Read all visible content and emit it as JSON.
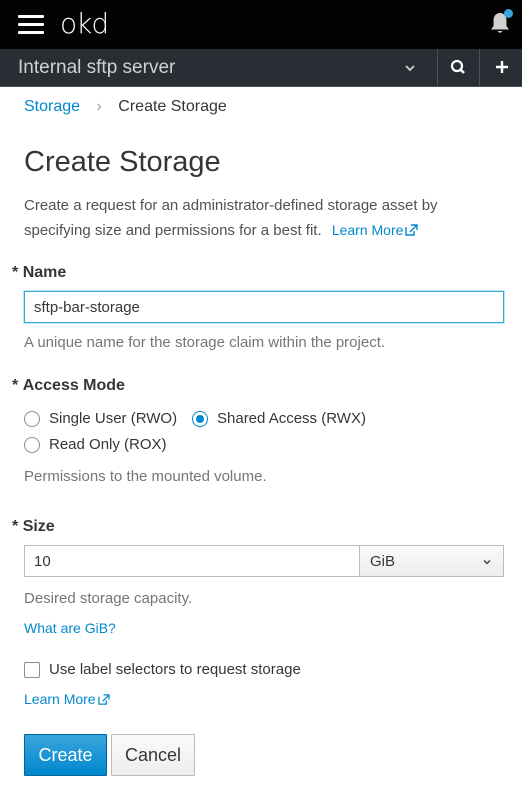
{
  "header": {
    "logo_text": "okd",
    "menu_icon": "hamburger-menu-icon",
    "notification_icon": "bell-icon"
  },
  "project_bar": {
    "project_name": "Internal sftp server",
    "search_icon": "search-icon",
    "add_icon": "plus-icon"
  },
  "breadcrumb": {
    "parent": "Storage",
    "separator": "›",
    "current": "Create Storage"
  },
  "page": {
    "title": "Create Storage",
    "description": "Create a request for an administrator-defined storage asset by specifying size and permissions for a best fit.",
    "learn_more": "Learn More"
  },
  "form": {
    "name": {
      "required_mark": "*",
      "label": "Name",
      "value": "sftp-bar-storage",
      "help": "A unique name for the storage claim within the project."
    },
    "access_mode": {
      "required_mark": "*",
      "label": "Access Mode",
      "options": [
        {
          "label": "Single User (RWO)",
          "checked": false
        },
        {
          "label": "Shared Access (RWX)",
          "checked": true
        },
        {
          "label": "Read Only (ROX)",
          "checked": false
        }
      ],
      "help": "Permissions to the mounted volume."
    },
    "size": {
      "required_mark": "*",
      "label": "Size",
      "value": "10",
      "unit": "GiB",
      "help": "Desired storage capacity.",
      "unit_link": "What are GiB?"
    },
    "label_selectors": {
      "label": "Use label selectors to request storage",
      "checked": false,
      "learn_more": "Learn More"
    }
  },
  "buttons": {
    "create": "Create",
    "cancel": "Cancel"
  },
  "colors": {
    "accent": "#0088ce",
    "header_bg": "#030303",
    "project_bar_bg": "#292e34",
    "notification_dot": "#39a5dc"
  }
}
